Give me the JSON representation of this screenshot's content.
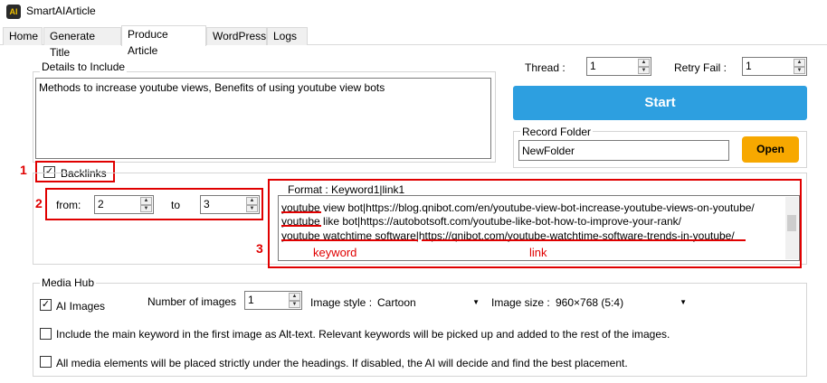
{
  "app": {
    "title": "SmartAIArticle",
    "icon_text": "AI"
  },
  "tabs": [
    {
      "label": "Home"
    },
    {
      "label": "Generate Title"
    },
    {
      "label": "Produce Article"
    },
    {
      "label": "WordPress"
    },
    {
      "label": "Logs"
    }
  ],
  "details": {
    "group_label": "Details to Include",
    "text": "Methods to increase youtube views, Benefits of using youtube view bots"
  },
  "thread": {
    "label": "Thread :",
    "value": "1"
  },
  "retry": {
    "label": "Retry Fail :",
    "value": "1"
  },
  "start_label": "Start",
  "record_folder": {
    "group_label": "Record Folder",
    "value": "NewFolder",
    "open_label": "Open"
  },
  "backlinks": {
    "label": "Backlinks",
    "checked": true
  },
  "range": {
    "from_label": "from:",
    "from_value": "2",
    "to_label": "to",
    "to_value": "3"
  },
  "format": {
    "label": "Format : Keyword1|link1",
    "lines": [
      "youtube view bot|https://blog.qnibot.com/en/youtube-view-bot-increase-youtube-views-on-youtube/",
      "youtube like bot|https://autobotsoft.com/youtube-like-bot-how-to-improve-your-rank/",
      "youtube watchtime software|https://qnibot.com/youtube-watchtime-software-trends-in-youtube/"
    ],
    "keyword_annotation": "keyword",
    "link_annotation": "link"
  },
  "annotations": {
    "n1": "1",
    "n2": "2",
    "n3": "3"
  },
  "media": {
    "group_label": "Media Hub",
    "ai_images_label": "AI Images",
    "num_images_label": "Number of images",
    "num_images_value": "1",
    "style_label": "Image style :",
    "style_value": "Cartoon",
    "size_label": "Image size :",
    "size_value": "960×768 (5:4)",
    "alt_text_option": "Include the main keyword in the first image as Alt-text. Relevant keywords will be picked up and added to the rest of the images.",
    "placement_option": "All media elements will be placed strictly under the headings. If disabled, the AI will decide and find the best placement."
  },
  "colors": {
    "accent": "#2d9fe0",
    "open": "#f7a800",
    "annotation": "#e00000"
  }
}
